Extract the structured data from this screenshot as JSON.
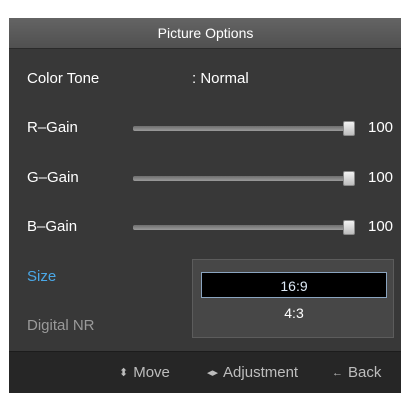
{
  "title": "Picture Options",
  "color_tone": {
    "label": "Color Tone",
    "value": ": Normal"
  },
  "r_gain": {
    "label": "R–Gain",
    "value": "100",
    "level": 1.0
  },
  "g_gain": {
    "label": "G–Gain",
    "value": "100",
    "level": 1.0
  },
  "b_gain": {
    "label": "B–Gain",
    "value": "100",
    "level": 1.0
  },
  "size": {
    "label": "Size",
    "options": [
      "16:9",
      "4:3"
    ],
    "selected": "16:9"
  },
  "digital_nr": {
    "label": "Digital NR"
  },
  "footer": {
    "move": {
      "icon": "up-down-arrows-icon",
      "glyph": "⬍",
      "label": "Move"
    },
    "adjustment": {
      "icon": "left-right-arrows-icon",
      "glyph": "◂▸",
      "label": "Adjustment"
    },
    "back": {
      "icon": "back-arrow-icon",
      "glyph": "←",
      "label": "Back"
    }
  },
  "colors": {
    "accent": "#4aa8e8",
    "panel": "#383838",
    "footer": "#262626"
  }
}
